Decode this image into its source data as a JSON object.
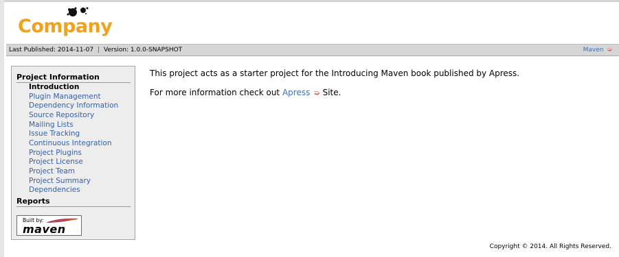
{
  "logo": {
    "text": "Company",
    "icon": "ink-splat-icon",
    "color": "#f0a21d"
  },
  "info_bar": {
    "last_published": "Last Published: 2014-11-07",
    "separator": "|",
    "version": "Version: 1.0.0-SNAPSHOT",
    "maven_link": "Maven",
    "external_icon": "external-link-icon"
  },
  "sidebar": {
    "project_info_heading": "Project Information",
    "items": [
      {
        "label": "Introduction",
        "current": true
      },
      {
        "label": "Plugin Management"
      },
      {
        "label": "Dependency Information"
      },
      {
        "label": "Source Repository"
      },
      {
        "label": "Mailing Lists"
      },
      {
        "label": "Issue Tracking"
      },
      {
        "label": "Continuous Integration"
      },
      {
        "label": "Project Plugins"
      },
      {
        "label": "Project License"
      },
      {
        "label": "Project Team"
      },
      {
        "label": "Project Summary"
      },
      {
        "label": "Dependencies"
      }
    ],
    "reports_heading": "Reports",
    "built_by": {
      "small": "Built by:",
      "brand": "maven",
      "icon": "maven-feather-icon"
    }
  },
  "main": {
    "description": "This project acts as a starter project for the Introducing Maven book published by Apress.",
    "more_info_prefix": "For more information check out",
    "apress_link": "Apress",
    "more_info_suffix": "Site."
  },
  "footer": {
    "copyright": "Copyright © 2014. All Rights Reserved."
  },
  "colors": {
    "link": "#3360ad",
    "accent": "#f0a21d",
    "bar": "#d6d6d6",
    "sidebar": "#ededed"
  }
}
